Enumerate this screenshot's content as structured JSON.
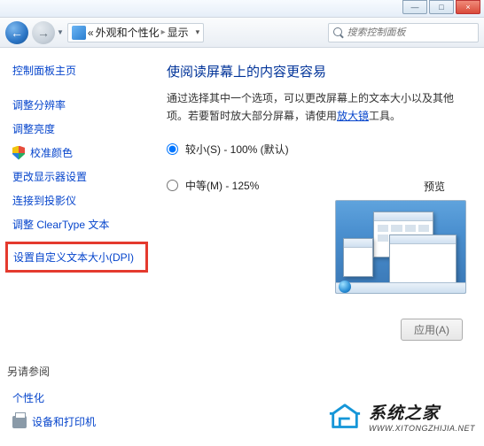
{
  "chrome": {
    "min": "—",
    "max": "□",
    "close": "×"
  },
  "nav": {
    "back_glyph": "←",
    "fwd_glyph": "→",
    "breadcrumb_prefix": "«",
    "crumb1": "外观和个性化",
    "crumb2": "显示",
    "search_placeholder": "搜索控制面板"
  },
  "sidebar": {
    "home": "控制面板主页",
    "items": [
      "调整分辨率",
      "调整亮度",
      "校准颜色",
      "更改显示器设置",
      "连接到投影仪",
      "调整 ClearType 文本"
    ],
    "highlight": "设置自定义文本大小(DPI)",
    "footer_title": "另请参阅",
    "footer_items": [
      "个性化",
      "设备和打印机"
    ]
  },
  "content": {
    "title": "使阅读屏幕上的内容更容易",
    "desc_a": "通过选择其中一个选项，可以更改屏幕上的文本大小以及其他项。若要暂时放大部分屏幕，请使用",
    "desc_link": "放大镜",
    "desc_b": "工具。",
    "opt_small": "较小(S) - 100% (默认)",
    "opt_medium": "中等(M) - 125%",
    "preview_label": "预览",
    "apply": "应用(A)"
  },
  "watermark": {
    "cn": "系统之家",
    "en": "WWW.XITONGZHIJIA.NET"
  },
  "colors": {
    "link": "#0645cc",
    "title": "#003399",
    "highlight_border": "#e43a2e"
  }
}
